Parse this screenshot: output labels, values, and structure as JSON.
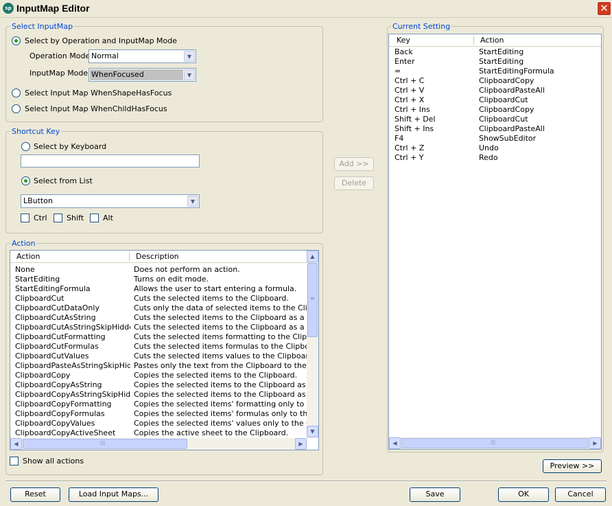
{
  "window": {
    "title": "InputMap Editor",
    "icon_text": "sp",
    "close_symbol": "✕"
  },
  "select_inputmap": {
    "legend": "Select InputMap",
    "opt_operation": "Select by Operation and InputMap Mode",
    "operation_mode_label": "Operation Mode",
    "operation_mode_value": "Normal",
    "inputmap_mode_label": "InputMap Mode",
    "inputmap_mode_value": "WhenFocused",
    "opt_shape": "Select Input Map WhenShapeHasFocus",
    "opt_child": "Select Input Map WhenChildHasFocus"
  },
  "shortcut_key": {
    "legend": "Shortcut Key",
    "opt_keyboard": "Select by Keyboard",
    "keyboard_value": "",
    "opt_list": "Select from List",
    "list_value": "LButton",
    "ctrl_label": "Ctrl",
    "shift_label": "Shift",
    "alt_label": "Alt"
  },
  "middle_buttons": {
    "add": "Add >>",
    "delete": "Delete"
  },
  "action_group": {
    "legend": "Action",
    "col_action": "Action",
    "col_description": "Description",
    "rows": [
      [
        "None",
        "Does not perform an action."
      ],
      [
        "StartEditing",
        "Turns on edit mode."
      ],
      [
        "StartEditingFormula",
        "Allows the user to start entering a formula."
      ],
      [
        "ClipboardCut",
        "Cuts the selected items to the Clipboard."
      ],
      [
        "ClipboardCutDataOnly",
        "Cuts only the data of selected items to the Clipboard."
      ],
      [
        "ClipboardCutAsString",
        "Cuts the selected items to the Clipboard as a string."
      ],
      [
        "ClipboardCutAsStringSkipHidden",
        "Cuts the selected items to the Clipboard as a string, sk"
      ],
      [
        "ClipboardCutFormatting",
        "Cuts the selected items formatting to the Clipboard."
      ],
      [
        "ClipboardCutFormulas",
        "Cuts the selected items formulas to the Clipboard."
      ],
      [
        "ClipboardCutValues",
        "Cuts the selected items values to the Clipboard."
      ],
      [
        "ClipboardPasteAsStringSkipHidden",
        "Pastes only the text from the Clipboard to the current c"
      ],
      [
        "ClipboardCopy",
        "Copies the selected items to the Clipboard."
      ],
      [
        "ClipboardCopyAsString",
        "Copies the selected items to the Clipboard as a string."
      ],
      [
        "ClipboardCopyAsStringSkipHidden",
        "Copies the selected items to the Clipboard as a string"
      ],
      [
        "ClipboardCopyFormatting",
        "Copies the selected items' formatting only to the Clipbo"
      ],
      [
        "ClipboardCopyFormulas",
        "Copies the selected items' formulas only to the Clipboa"
      ],
      [
        "ClipboardCopyValues",
        "Copies the selected items' values only to the Clipboar"
      ],
      [
        "ClipboardCopyActiveSheet",
        "Copies the active sheet to the Clipboard."
      ]
    ],
    "show_all_label": "Show all actions"
  },
  "current_setting": {
    "legend": "Current Setting",
    "col_key": "Key",
    "col_action": "Action",
    "rows": [
      [
        "Back",
        "StartEditing"
      ],
      [
        "Enter",
        "StartEditing"
      ],
      [
        "=",
        "StartEditingFormula"
      ],
      [
        "Ctrl + C",
        "ClipboardCopy"
      ],
      [
        "Ctrl + V",
        "ClipboardPasteAll"
      ],
      [
        "Ctrl + X",
        "ClipboardCut"
      ],
      [
        "Ctrl + Ins",
        "ClipboardCopy"
      ],
      [
        "Shift + Del",
        "ClipboardCut"
      ],
      [
        "Shift + Ins",
        "ClipboardPasteAll"
      ],
      [
        "F4",
        "ShowSubEditor"
      ],
      [
        "Ctrl + Z",
        "Undo"
      ],
      [
        "Ctrl + Y",
        "Redo"
      ]
    ]
  },
  "footer": {
    "preview": "Preview >>",
    "reset": "Reset",
    "load": "Load Input Maps...",
    "save": "Save",
    "ok": "OK",
    "cancel": "Cancel"
  },
  "icons": {
    "dropdown": "▼",
    "scroll_up": "▲",
    "scroll_down": "▼",
    "scroll_left": "◀",
    "scroll_right": "▶",
    "grip_v": "≡",
    "grip_h": "|||"
  }
}
